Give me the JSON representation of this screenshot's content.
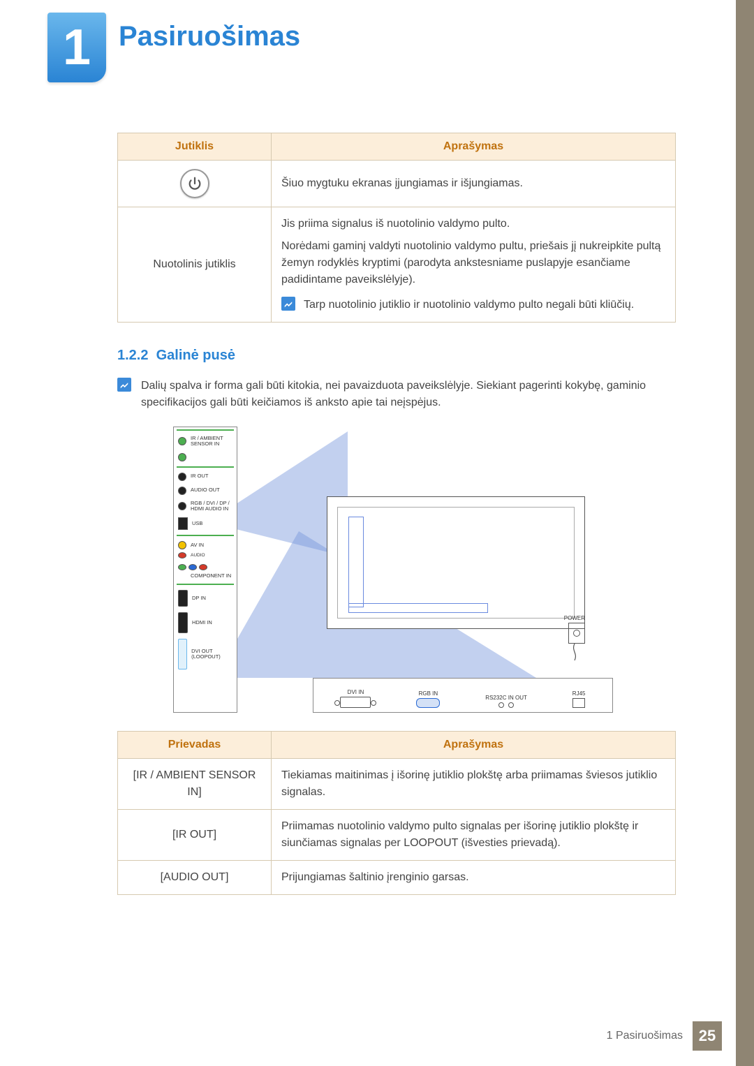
{
  "chapter": {
    "number": "1",
    "title": "Pasiruošimas"
  },
  "table1": {
    "headers": {
      "col1": "Jutiklis",
      "col2": "Aprašymas"
    },
    "rows": [
      {
        "sensor_icon": "power",
        "desc": "Šiuo mygtuku ekranas įjungiamas ir išjungiamas."
      },
      {
        "sensor_label": "Nuotolinis jutiklis",
        "desc_line1": "Jis priima signalus iš nuotolinio valdymo pulto.",
        "desc_line2": "Norėdami gaminį valdyti nuotolinio valdymo pultu, priešais jį nukreipkite pultą žemyn rodyklės kryptimi (parodyta ankstesniame puslapyje esančiame padidintame paveikslėlyje).",
        "note": "Tarp nuotolinio jutiklio ir nuotolinio valdymo pulto negali būti kliūčių."
      }
    ]
  },
  "section": {
    "number": "1.2.2",
    "title": "Galinė pusė"
  },
  "section_note": "Dalių spalva ir forma gali būti kitokia, nei pavaizduota paveikslėlyje. Siekiant pagerinti kokybę, gaminio specifikacijos gali būti keičiamos iš anksto apie tai neįspėjus.",
  "diagram": {
    "side_ports": [
      "IR / AMBIENT SENSOR IN",
      "IR OUT",
      "AUDIO OUT",
      "RGB / DVI / DP / HDMI AUDIO IN",
      "USB",
      "AV IN",
      "COMPONENT IN",
      "DP IN",
      "HDMI IN",
      "DVI OUT (LOOPOUT)"
    ],
    "bottom_ports": [
      "DVI IN",
      "RGB IN",
      "RS232C IN OUT",
      "RJ45"
    ],
    "power_label": "POWER",
    "audio_sublabel": "AUDIO"
  },
  "table2": {
    "headers": {
      "col1": "Prievadas",
      "col2": "Aprašymas"
    },
    "rows": [
      {
        "port": "[IR / AMBIENT SENSOR IN]",
        "desc": "Tiekiamas maitinimas į išorinę jutiklio plokštę arba priimamas šviesos jutiklio signalas."
      },
      {
        "port": "[IR OUT]",
        "desc": "Priimamas nuotolinio valdymo pulto signalas per išorinę jutiklio plokštę ir siunčiamas signalas per LOOPOUT (išvesties prievadą)."
      },
      {
        "port": "[AUDIO OUT]",
        "desc": "Prijungiamas šaltinio įrenginio garsas."
      }
    ]
  },
  "footer": {
    "label": "1 Pasiruošimas",
    "page": "25"
  }
}
